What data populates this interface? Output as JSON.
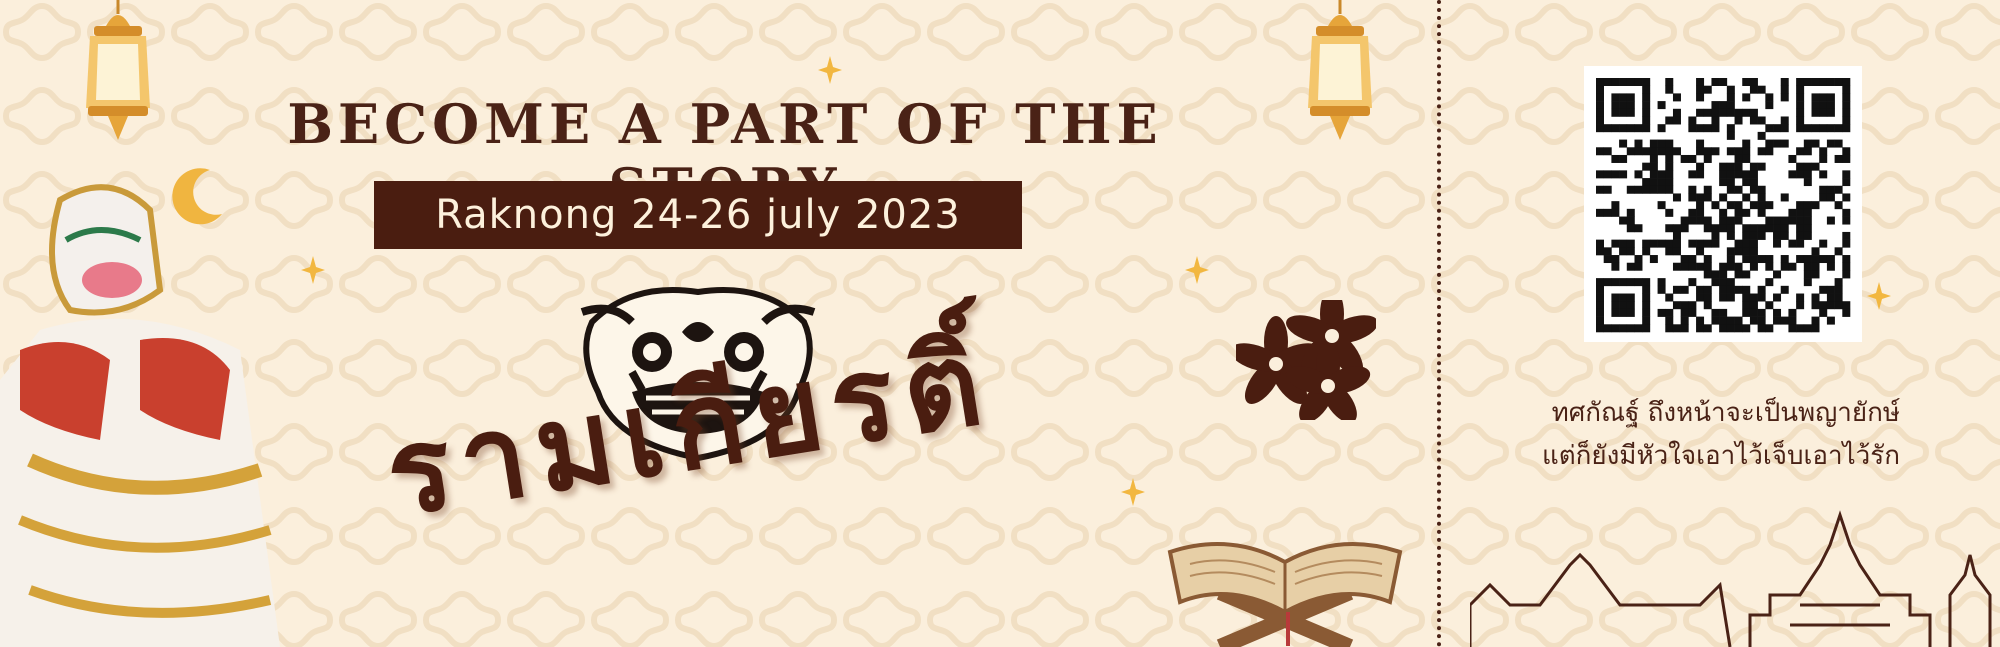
{
  "banner": {
    "headline": "BECOME A PART OF THE STORY",
    "event_date": "Raknong 24-26 july 2023",
    "title_thai": "รามเกียรติ์",
    "poem_line_1": "ทศกัณฐ์ ถึงหน้าจะเป็นพญายักษ์",
    "poem_line_2": "แต่ก็ยังมีหัวใจเอาไว้เจ็บเอาไว้รัก"
  },
  "colors": {
    "background": "#fbefdc",
    "brown": "#4a1d10",
    "gold": "#f2b740"
  },
  "icons": [
    "lantern-icon",
    "crescent-moon-icon",
    "sparkle-icon",
    "yaksha-mask-icon",
    "flower-icon",
    "book-stand-icon",
    "temple-outline-icon",
    "qr-code"
  ]
}
